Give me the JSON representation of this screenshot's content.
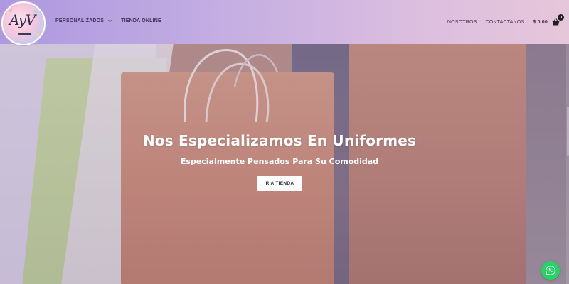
{
  "header": {
    "logo": {
      "text": "AyV",
      "icon": "ayv-logo"
    },
    "nav_left": [
      {
        "label": "PERSONALIZADOS",
        "has_dropdown": true
      },
      {
        "label": "TIENDA ONLINE",
        "has_dropdown": false
      }
    ],
    "nav_right": [
      {
        "label": "NOSOTROS"
      },
      {
        "label": "CONTACTANOS"
      }
    ],
    "cart": {
      "amount": "$ 0.00",
      "count": "0",
      "icon": "shopping-basket-icon"
    }
  },
  "hero": {
    "title": "Nos Especializamos En Uniformes",
    "subtitle": "Especialmente Pensados Para Su Comodidad",
    "button_label": "IR A TIENDA",
    "background": "shopping-bags-photo"
  },
  "floating": {
    "whatsapp_icon": "whatsapp-icon",
    "color": "#25d366"
  },
  "colors": {
    "header_start": "#ae98e0",
    "header_end": "#e6c6da",
    "accent_text": "#3d3254"
  }
}
